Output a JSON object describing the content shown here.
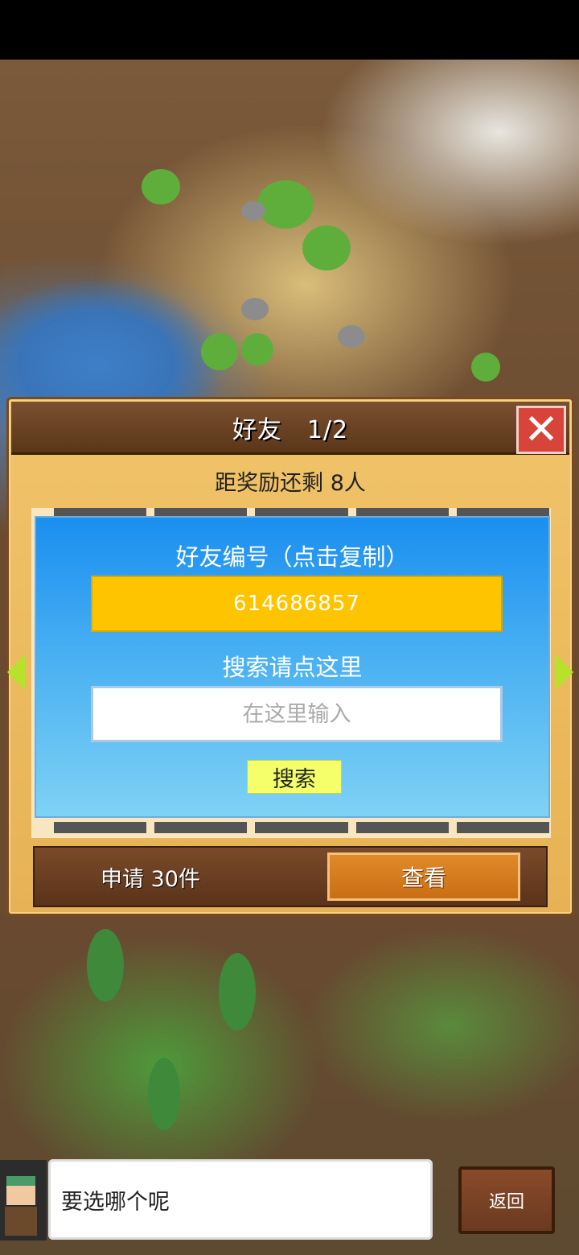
{
  "dialog": {
    "title": "好友　1/2",
    "close_icon": "close-x-icon",
    "reward_text": "距奖励还剩 8人"
  },
  "search_panel": {
    "friend_id_label": "好友编号（点击复制）",
    "friend_id_value": "614686857",
    "search_label": "搜索请点这里",
    "search_placeholder": "在这里输入",
    "search_button": "搜索"
  },
  "requests": {
    "label": "申请 30件",
    "view_button": "查看"
  },
  "message": {
    "text": "要选哪个呢"
  },
  "back_button": "返回",
  "colors": {
    "panel_blue": "#1a8ff0",
    "id_yellow": "#ffc400",
    "close_red": "#d8443a",
    "view_orange": "#e08a2a",
    "arrow_green": "#b6e22b"
  }
}
